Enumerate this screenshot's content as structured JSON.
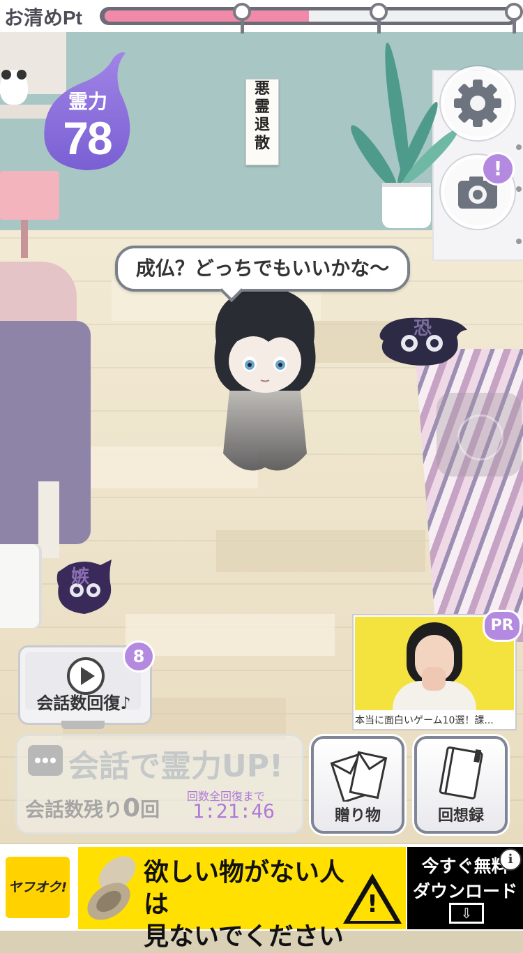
{
  "points": {
    "label": "お清めPt",
    "progress": 0.5
  },
  "spirit_power": {
    "label": "霊力",
    "value": "78"
  },
  "talisman": {
    "chars": [
      "悪",
      "霊",
      "退",
      "散"
    ]
  },
  "speech": {
    "text": "成仏？どっちでもいいかな～"
  },
  "enemies": {
    "enemy1_char": "恐",
    "enemy2_char": "嫉"
  },
  "camera_badge": "!",
  "chat_restore": {
    "label": "会話数回復♪",
    "badge": "8"
  },
  "chat_power": {
    "title": "会話で霊力UP!",
    "remaining_prefix": "会話数残り",
    "remaining_count": "0",
    "remaining_suffix": "回",
    "restore_label": "回数全回復まで",
    "restore_timer": "1:21:46"
  },
  "buttons": {
    "gift": "贈り物",
    "memories": "回想録"
  },
  "pr_ad": {
    "badge": "PR",
    "caption": "本当に面白いゲーム10選！課..."
  },
  "banner_ad": {
    "brand": "ヤフオク!",
    "line1": "欲しい物がない人は",
    "line2": "見ないでください",
    "warning": "!",
    "cta_line1": "今すぐ無料",
    "cta_line2": "ダウンロード",
    "info": "i"
  },
  "colors": {
    "accent_purple": "#b48ae0",
    "progress_pink": "#f08aa8",
    "wall": "#a7c6c4",
    "ad_yellow": "#ffe000"
  },
  "icons": [
    "gear-icon",
    "camera-icon",
    "play-icon",
    "chat-bubble-icon",
    "envelope-icon",
    "notebook-icon",
    "warning-icon",
    "download-icon",
    "info-icon"
  ]
}
